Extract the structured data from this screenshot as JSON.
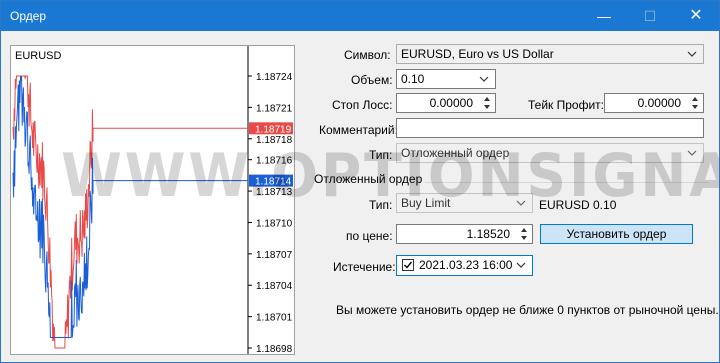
{
  "window": {
    "title": "Ордер",
    "minimize_glyph": "—",
    "maximize_glyph": "☐",
    "close_glyph": "✕"
  },
  "chart": {
    "symbol": "EURUSD",
    "price_ticks": [
      "1.18724",
      "1.18721",
      "1.18718",
      "1.18716",
      "1.18713",
      "1.18710",
      "1.18707",
      "1.18704",
      "1.18701",
      "1.18698"
    ],
    "ask_label": "1.18719",
    "bid_label": "1.18714",
    "ask_price": 1.18719,
    "bid_price": 1.18714,
    "ask_color": "#e84a4a",
    "bid_color": "#1a5fd6"
  },
  "form": {
    "symbol_label": "Символ:",
    "symbol_value": "EURUSD, Euro vs US Dollar",
    "volume_label": "Объем:",
    "volume_value": "0.10",
    "stop_loss_label": "Стоп Лосс:",
    "stop_loss_value": "0.00000",
    "take_profit_label": "Тейк Профит:",
    "take_profit_value": "0.00000",
    "comment_label": "Комментарий:",
    "comment_value": "",
    "type_label": "Тип:",
    "type_value": "Отложенный ордер",
    "pending_group_title": "Отложенный ордер",
    "pending_type_label": "Тип:",
    "pending_type_value": "Buy Limit",
    "pending_info": "EURUSD 0.10",
    "price_label": "по цене:",
    "price_value": "1.18520",
    "place_button": "Установить ордер",
    "expiry_label": "Истечение:",
    "expiry_value": "2021.03.23 16:00",
    "expiry_checked": true,
    "note": "Вы можете установить ордер не ближе 0 пунктов от рыночной цены."
  },
  "watermark_text": "WWW.OPTIONSIGNALS.COM",
  "icons": [
    "chevron-down-icon",
    "spin-up-icon",
    "spin-down-icon",
    "checkmark-icon"
  ]
}
